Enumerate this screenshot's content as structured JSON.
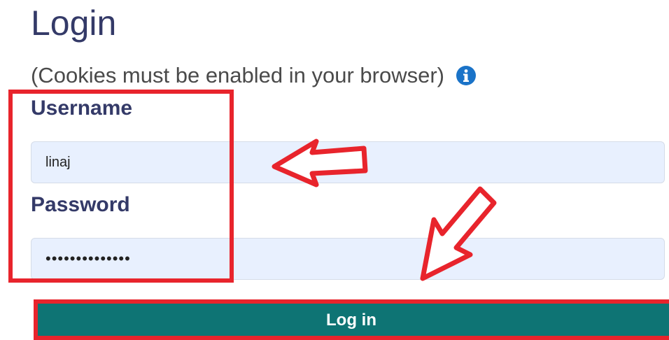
{
  "page": {
    "title": "Login",
    "cookies_note": "(Cookies must be enabled in your browser)",
    "info_icon": "info-circle-icon"
  },
  "form": {
    "username_label": "Username",
    "username_value": "linaj",
    "password_label": "Password",
    "password_value": "••••••••••••••",
    "login_button_label": "Log in"
  },
  "colors": {
    "heading": "#343a68",
    "info_icon": "#1a73c8",
    "input_background": "#e8f0fe",
    "login_button": "#0e7474",
    "annotation_red": "#e8242c"
  }
}
